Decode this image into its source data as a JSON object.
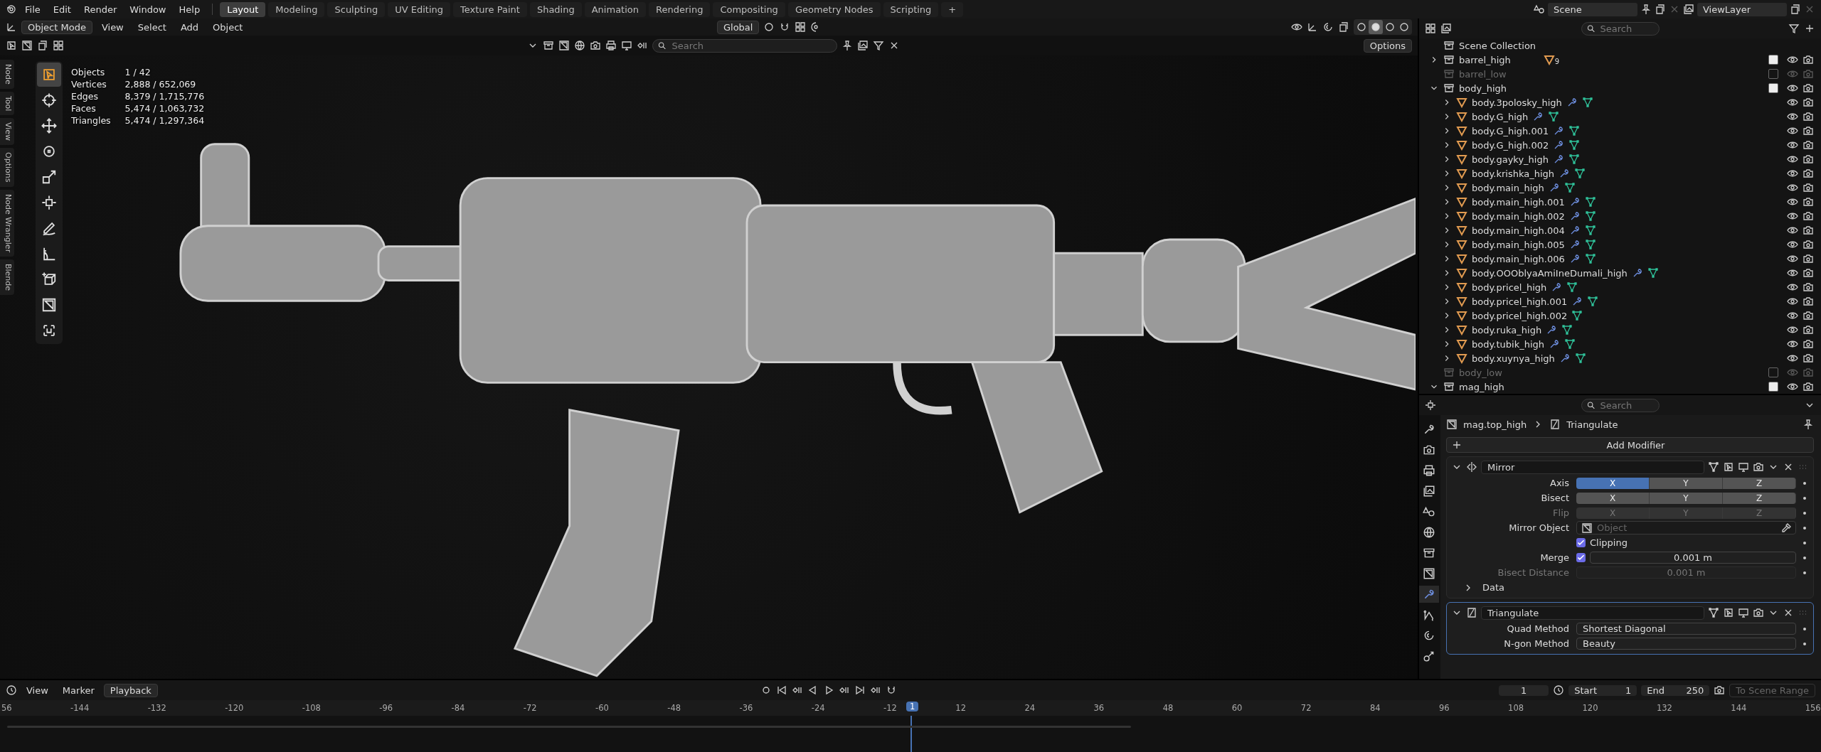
{
  "menubar": {
    "menus": [
      "File",
      "Edit",
      "Render",
      "Window",
      "Help"
    ],
    "workspaces": [
      {
        "label": "Layout",
        "selected": true
      },
      {
        "label": "Modeling",
        "selected": false
      },
      {
        "label": "Sculpting",
        "selected": false
      },
      {
        "label": "UV Editing",
        "selected": false
      },
      {
        "label": "Texture Paint",
        "selected": false
      },
      {
        "label": "Shading",
        "selected": false
      },
      {
        "label": "Animation",
        "selected": false
      },
      {
        "label": "Rendering",
        "selected": false
      },
      {
        "label": "Compositing",
        "selected": false
      },
      {
        "label": "Geometry Nodes",
        "selected": false
      },
      {
        "label": "Scripting",
        "selected": false
      }
    ],
    "add_workspace": "+",
    "scene": "Scene",
    "view_layer": "ViewLayer"
  },
  "viewport": {
    "mode": "Object Mode",
    "menus": [
      "View",
      "Select",
      "Add",
      "Object"
    ],
    "orientation": "Global",
    "search_placeholder": "Search",
    "options": "Options",
    "shading_modes": [
      {
        "selected": false
      },
      {
        "selected": true
      },
      {
        "selected": false
      },
      {
        "selected": false
      }
    ],
    "side_tabs": [
      "Node",
      "Tool",
      "View",
      "Options",
      "Node Wrangler",
      "Blende"
    ],
    "tools": [
      {
        "selected": true
      },
      {
        "selected": false
      },
      {
        "selected": false
      },
      {
        "selected": false
      },
      {
        "selected": false
      },
      {
        "selected": false
      },
      {
        "selected": false
      },
      {
        "selected": false
      },
      {
        "selected": false
      },
      {
        "selected": false
      },
      {
        "selected": false
      }
    ],
    "stats": [
      {
        "label": "Objects",
        "value": "1 / 42"
      },
      {
        "label": "Vertices",
        "value": "2,888 / 652,069"
      },
      {
        "label": "Edges",
        "value": "8,379 / 1,715,776"
      },
      {
        "label": "Faces",
        "value": "5,474 / 1,063,732"
      },
      {
        "label": "Triangles",
        "value": "5,474 / 1,297,364"
      }
    ]
  },
  "outliner": {
    "search_placeholder": "Search",
    "root": "Scene Collection",
    "items": [
      {
        "kind": "collection",
        "name": "barrel_high",
        "expanded": false,
        "checked": true,
        "count": "9"
      },
      {
        "kind": "collection",
        "name": "barrel_low",
        "checked": false
      },
      {
        "kind": "collection",
        "name": "body_high",
        "expanded": true,
        "checked": true,
        "children": [
          {
            "kind": "object",
            "name": "body.3polosky_high",
            "expanded": false,
            "modifiers": true
          },
          {
            "kind": "object",
            "name": "body.G_high",
            "expanded": false,
            "modifiers": true
          },
          {
            "kind": "object",
            "name": "body.G_high.001",
            "expanded": false,
            "modifiers": true
          },
          {
            "kind": "object",
            "name": "body.G_high.002",
            "expanded": false,
            "modifiers": true
          },
          {
            "kind": "object",
            "name": "body.gayky_high",
            "expanded": false,
            "modifiers": true
          },
          {
            "kind": "object",
            "name": "body.krishka_high",
            "expanded": false,
            "modifiers": true
          },
          {
            "kind": "object",
            "name": "body.main_high",
            "expanded": false,
            "modifiers": true
          },
          {
            "kind": "object",
            "name": "body.main_high.001",
            "expanded": false,
            "modifiers": true
          },
          {
            "kind": "object",
            "name": "body.main_high.002",
            "expanded": false,
            "modifiers": true
          },
          {
            "kind": "object",
            "name": "body.main_high.004",
            "expanded": false,
            "modifiers": true
          },
          {
            "kind": "object",
            "name": "body.main_high.005",
            "expanded": false,
            "modifiers": true
          },
          {
            "kind": "object",
            "name": "body.main_high.006",
            "expanded": false,
            "modifiers": true
          },
          {
            "kind": "object",
            "name": "body.OOOblyaAmiIneDumali_high",
            "expanded": false,
            "modifiers": true
          },
          {
            "kind": "object",
            "name": "body.pricel_high",
            "expanded": false,
            "modifiers": true
          },
          {
            "kind": "object",
            "name": "body.pricel_high.001",
            "expanded": false,
            "modifiers": true
          },
          {
            "kind": "object",
            "name": "body.pricel_high.002",
            "expanded": false,
            "modifiers": false
          },
          {
            "kind": "object",
            "name": "body.ruka_high",
            "expanded": false,
            "modifiers": true
          },
          {
            "kind": "object",
            "name": "body.tubik_high",
            "expanded": false,
            "modifiers": true
          },
          {
            "kind": "object",
            "name": "body.xuynya_high",
            "expanded": false,
            "modifiers": true
          }
        ]
      },
      {
        "kind": "collection",
        "name": "body_low",
        "checked": false
      },
      {
        "kind": "collection",
        "name": "mag_high",
        "expanded": true,
        "checked": true
      }
    ]
  },
  "properties": {
    "search_placeholder": "Search",
    "object": "mag.top_high",
    "modifier": "Triangulate",
    "add_modifier": "Add Modifier",
    "tabs": [
      {
        "selected": false
      },
      {
        "selected": false
      },
      {
        "selected": false
      },
      {
        "selected": false
      },
      {
        "selected": false
      },
      {
        "selected": false
      },
      {
        "selected": false
      },
      {
        "selected": false
      },
      {
        "selected": true
      },
      {
        "selected": false
      },
      {
        "selected": false
      },
      {
        "selected": false
      }
    ],
    "modifiers": [
      {
        "name": "Mirror",
        "active": false,
        "expanded": true,
        "rows": [
          {
            "kind": "toggles",
            "label": "Axis",
            "disabled": false,
            "options": [
              {
                "label": "X",
                "selected": true
              },
              {
                "label": "Y",
                "selected": false
              },
              {
                "label": "Z",
                "selected": false
              }
            ]
          },
          {
            "kind": "toggles",
            "label": "Bisect",
            "disabled": false,
            "options": [
              {
                "label": "X",
                "selected": false
              },
              {
                "label": "Y",
                "selected": false
              },
              {
                "label": "Z",
                "selected": false
              }
            ]
          },
          {
            "kind": "toggles",
            "label": "Flip",
            "disabled": true,
            "options": [
              {
                "label": "X",
                "selected": false
              },
              {
                "label": "Y",
                "selected": false
              },
              {
                "label": "Z",
                "selected": false
              }
            ]
          },
          {
            "kind": "object",
            "label": "Mirror Object",
            "placeholder": "Object"
          },
          {
            "kind": "checkbox",
            "label": "Clipping",
            "checked": true
          },
          {
            "kind": "number",
            "label": "Merge",
            "checked": true,
            "value": "0.001 m",
            "disabled": false
          },
          {
            "kind": "number",
            "label": "Bisect Distance",
            "value": "0.001 m",
            "disabled": true
          },
          {
            "kind": "subpanel",
            "label": "Data",
            "expanded": false
          }
        ]
      },
      {
        "name": "Triangulate",
        "active": true,
        "expanded": true,
        "rows": [
          {
            "kind": "dropdown",
            "label": "Quad Method",
            "value": "Shortest Diagonal"
          },
          {
            "kind": "dropdown",
            "label": "N-gon Method",
            "value": "Beauty"
          }
        ]
      }
    ]
  },
  "timeline": {
    "menus": [
      "View",
      "Marker"
    ],
    "playback": "Playback",
    "current_frame": "1",
    "start_label": "Start",
    "start": "1",
    "end_label": "End",
    "end": "250",
    "range_button": "To Scene Range",
    "ticks": [
      "56",
      "-144",
      "-132",
      "-120",
      "-108",
      "-96",
      "-84",
      "-72",
      "-60",
      "-48",
      "-36",
      "-24",
      "-12",
      "12",
      "24",
      "36",
      "48",
      "60",
      "72",
      "84",
      "96",
      "108",
      "120",
      "132",
      "144",
      "156"
    ],
    "playhead": "1"
  }
}
